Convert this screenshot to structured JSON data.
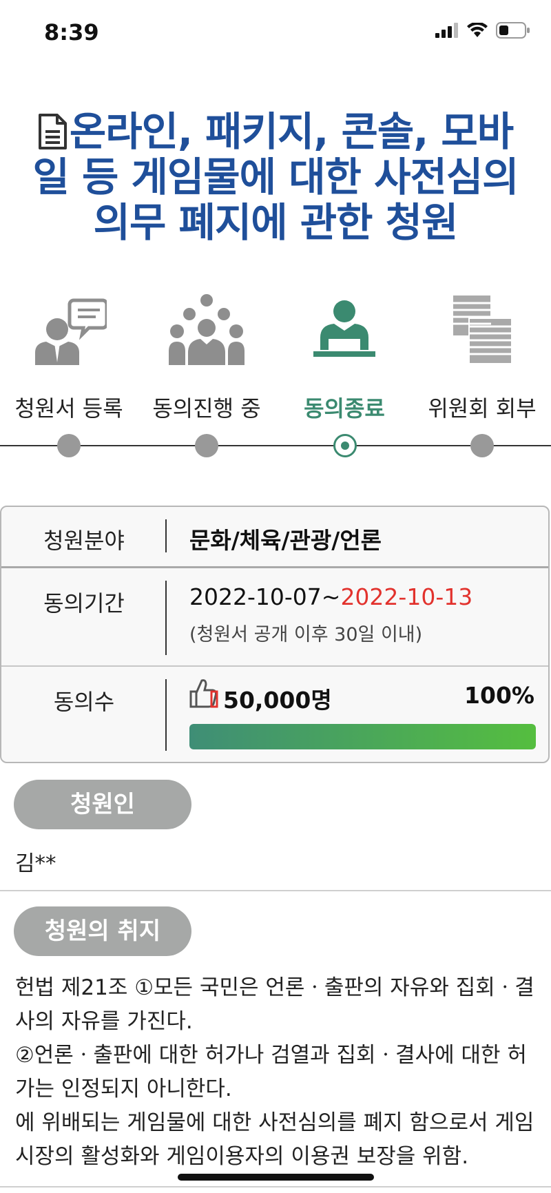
{
  "status": {
    "time": "8:39"
  },
  "petition": {
    "title": "온라인, 패키지, 콘솔, 모바일 등 게임물에 대한 사전심의 의무 폐지에 관한 청원",
    "title_lines": [
      "온라인, 패키지, 콘솔, 모바",
      "일 등 게임물에 대한 사전심의",
      "의무 폐지에 관한 청원"
    ]
  },
  "steps": [
    {
      "label": "청원서 등록",
      "icon": "speech-person-icon"
    },
    {
      "label": "동의진행 중",
      "icon": "crowd-icon"
    },
    {
      "label": "동의종료",
      "icon": "presenter-icon",
      "active": true
    },
    {
      "label": "위원회 회부",
      "icon": "document-stack-icon"
    }
  ],
  "info": {
    "field_label": "청원분야",
    "field_value": "문화/체육/관광/언론",
    "period_label": "동의기간",
    "period_start": "2022-10-07~",
    "period_end": "2022-10-13",
    "period_note": "(청원서 공개 이후 30일 이내)",
    "count_label": "동의수",
    "count_value": "50,000명",
    "percent": "100%",
    "progress": 1.0
  },
  "petitioner": {
    "label": "청원인",
    "name": "김**"
  },
  "purpose": {
    "label": "청원의 취지",
    "lines": [
      "헌법 제21조 ①모든 국민은 언론ㆍ출판의 자유와 집회ㆍ결",
      "사의 자유를 가진다.",
      "②언론ㆍ출판에 대한 허가나 검열과 집회ㆍ결사에 대한 허",
      "가는 인정되지 아니한다.",
      "에 위배되는 게임물에 대한 사전심의를 폐지 함으로서 게임",
      "시장의 활성화와 게임이용자의 이용권 보장을 위함."
    ]
  },
  "colors": {
    "title": "#1f4f9a",
    "active": "#3b8a70",
    "deadline": "#e2322d",
    "pill": "#a6a8a7"
  }
}
